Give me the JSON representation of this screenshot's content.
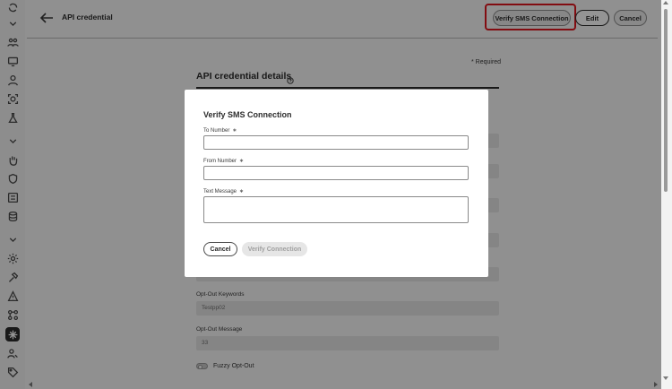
{
  "header": {
    "title": "API credential",
    "verify_label": "Verify SMS Connection",
    "edit_label": "Edit",
    "cancel_label": "Cancel"
  },
  "form": {
    "required_note": "* Required",
    "section_title": "API credential details",
    "opt_out_keywords_label": "Opt-Out Keywords",
    "opt_out_keywords_value": "Testpp02",
    "opt_out_message_label": "Opt-Out Message",
    "opt_out_message_value": "33",
    "fuzzy_opt_out_label": "Fuzzy Opt-Out"
  },
  "modal": {
    "title": "Verify SMS Connection",
    "to_number_label": "To Number",
    "from_number_label": "From Number",
    "text_message_label": "Text Message",
    "required_marker": "∗",
    "to_number_value": "",
    "from_number_value": "",
    "text_message_value": "",
    "cancel_label": "Cancel",
    "verify_label": "Verify Connection"
  },
  "colors": {
    "highlight": "#e0161e",
    "active_rail": "#2c2c2c"
  },
  "rail_icons": [
    "refresh-icon",
    "chevron-down-icon",
    "people-icon",
    "monitor-icon",
    "person-icon",
    "target-icon",
    "flask-icon",
    "chevron-down-icon",
    "hand-icon",
    "shield-icon",
    "list-icon",
    "database-icon",
    "chevron-down-icon",
    "gear-icon",
    "hammer-icon",
    "warning-icon",
    "workflow-icon",
    "asterisk-icon",
    "user-key-icon",
    "tag-icon"
  ]
}
